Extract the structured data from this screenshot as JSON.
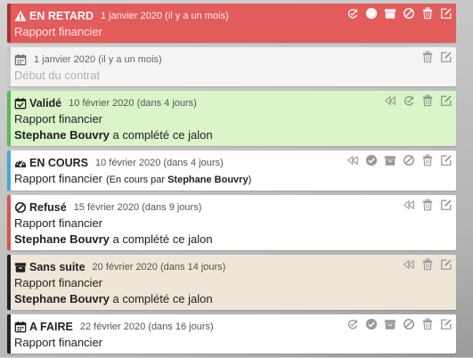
{
  "items": [
    {
      "status": "EN RETARD",
      "date": "1 janvier 2020 (il y a un mois)",
      "title": "Rapport financier",
      "status_icon": "warning-icon",
      "colors": {
        "bg": "#e25c5c",
        "border": "#a93232",
        "text": "#fff7f7",
        "date": "#ffecec",
        "title": "#fce4e4",
        "icon": "#fff2f2"
      },
      "actions": [
        "retry-icon",
        "check-circle-icon",
        "archive-icon",
        "ban-icon",
        "trash-icon",
        "edit-icon"
      ]
    },
    {
      "status": "",
      "date": "1 janvier 2020 (il y a un mois)",
      "title": "Début du contrat",
      "status_icon": "calendar-icon",
      "colors": {
        "bg": "#f5f5f5",
        "border": "#c8c8c8",
        "text": "#777777",
        "date": "#666666",
        "title": "#b0b0b0",
        "icon": "#9a9a9a"
      },
      "actions": [
        "trash-icon",
        "edit-icon"
      ]
    },
    {
      "status": "Validé",
      "date": "10 février 2020 (dans 4 jours)",
      "title": "Rapport financier",
      "completion_user": "Stephane Bouvry",
      "completion_text": " a complété ce jalon",
      "status_icon": "calendar-check-icon",
      "colors": {
        "bg": "#d9f5c9",
        "border": "#5cb85c",
        "text": "#222222",
        "date": "#555555",
        "title": "#222222",
        "icon": "#8a9a8a"
      },
      "actions": [
        "rewind-icon",
        "retry-icon",
        "trash-icon",
        "edit-icon"
      ]
    },
    {
      "status": "EN COURS",
      "date": "10 février 2020 (dans 4 jours)",
      "title": "Rapport financier",
      "detail_prefix": "(En cours par ",
      "detail_user": "Stephane Bouvry",
      "detail_suffix": ")",
      "status_icon": "gauge-icon",
      "colors": {
        "bg": "#ffffff",
        "border": "#46a8d8",
        "text": "#222222",
        "date": "#555555",
        "title": "#222222",
        "icon": "#9a9a9a"
      },
      "actions": [
        "rewind-icon",
        "check-circle-icon",
        "archive-icon",
        "ban-icon",
        "trash-icon",
        "edit-icon"
      ]
    },
    {
      "status": "Refusé",
      "date": "15 février 2020 (dans 9 jours)",
      "title": "Rapport financier",
      "completion_user": "Stephane Bouvry",
      "completion_text": " a complété ce jalon",
      "status_icon": "ban-icon",
      "colors": {
        "bg": "#ffffff",
        "border": "#d9534f",
        "text": "#222222",
        "date": "#555555",
        "title": "#222222",
        "icon": "#9a9a9a"
      },
      "actions": [
        "rewind-icon",
        "trash-icon",
        "edit-icon"
      ]
    },
    {
      "status": "Sans suite",
      "date": "20 février 2020 (dans 14 jours)",
      "title": "Rapport financier",
      "completion_user": "Stephane Bouvry",
      "completion_text": " a complété ce jalon",
      "status_icon": "archive-icon",
      "colors": {
        "bg": "#efe6d8",
        "border": "#222222",
        "text": "#222222",
        "date": "#555555",
        "title": "#222222",
        "icon": "#9a9a9a"
      },
      "actions": [
        "rewind-icon",
        "trash-icon",
        "edit-icon"
      ]
    },
    {
      "status": "A FAIRE",
      "date": "22 février 2020 (dans 16 jours)",
      "title": "Rapport financier",
      "status_icon": "calendar-icon",
      "colors": {
        "bg": "#ffffff",
        "border": "#222222",
        "text": "#222222",
        "date": "#555555",
        "title": "#222222",
        "icon": "#9a9a9a"
      },
      "actions": [
        "retry-icon",
        "check-circle-icon",
        "archive-icon",
        "ban-icon",
        "trash-icon",
        "edit-icon"
      ]
    }
  ]
}
